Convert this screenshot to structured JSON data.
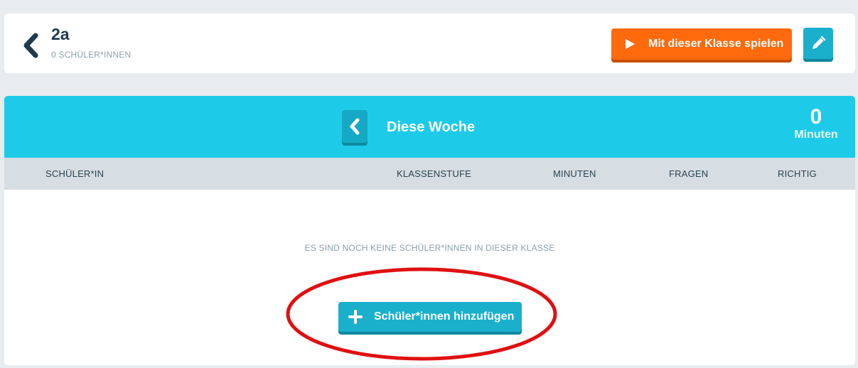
{
  "header": {
    "class_name": "2a",
    "student_count": "0 SCHÜLER*INNEN",
    "play_button_label": "Mit dieser Klasse spielen",
    "back_icon": "chevron-left-icon",
    "play_icon": "play-icon",
    "edit_icon": "pencil-icon"
  },
  "week": {
    "label": "Diese Woche",
    "minutes_value": "0",
    "minutes_unit": "Minuten",
    "prev_icon": "chevron-left-icon"
  },
  "table": {
    "columns": [
      "SCHÜLER*IN",
      "KLASSENSTUFE",
      "MINUTEN",
      "FRAGEN",
      "RICHTIG"
    ],
    "empty_message": "ES SIND NOCH KEINE SCHÜLER*INNEN IN DIESER KLASSE"
  },
  "add_students": {
    "label": "Schüler*innen hinzufügen",
    "icon": "plus-icon"
  },
  "colors": {
    "accent_cyan": "#1dcbe9",
    "button_teal": "#1ab0cc",
    "play_orange": "#ff6a0d",
    "annotation_red": "#e01010"
  }
}
